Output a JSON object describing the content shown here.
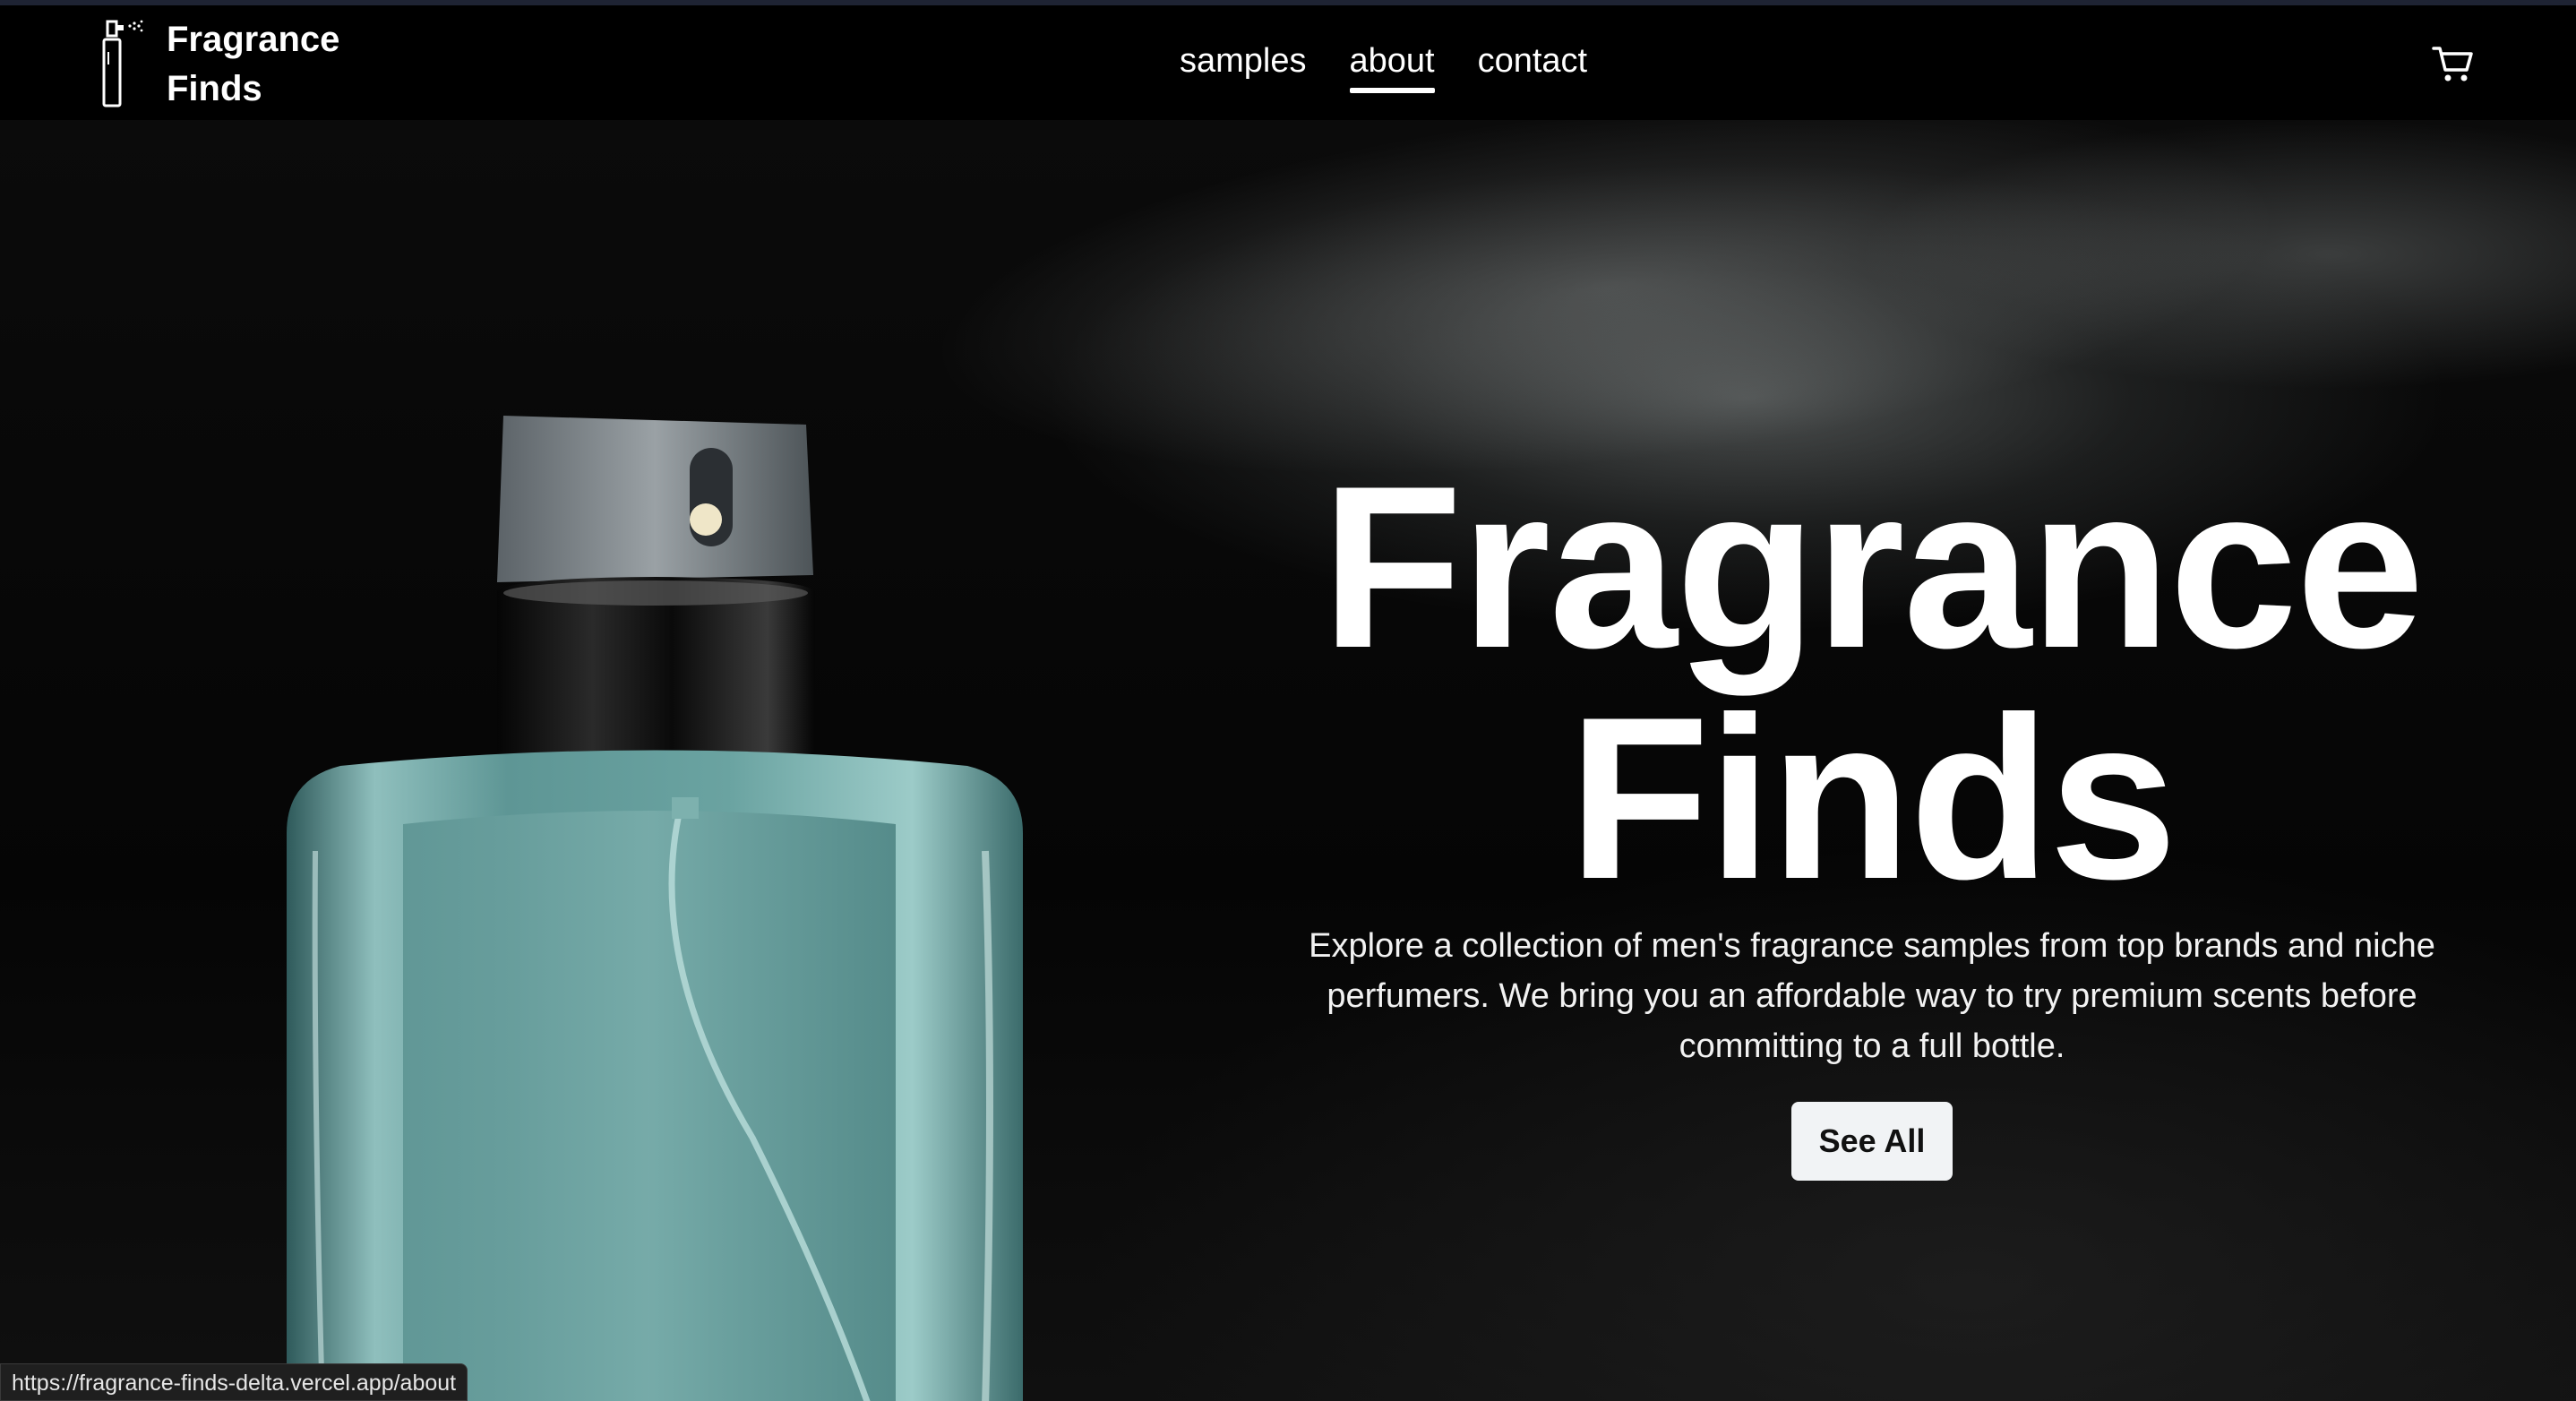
{
  "brand": {
    "name": "Fragrance Finds",
    "icon": "perfume-spray-icon"
  },
  "nav": {
    "links": [
      {
        "label": "samples",
        "active": false
      },
      {
        "label": "about",
        "active": true
      },
      {
        "label": "contact",
        "active": false
      }
    ],
    "cart_icon": "cart-icon"
  },
  "hero": {
    "title_line1": "Fragrance",
    "title_line2": "Finds",
    "description": "Explore a collection of men's fragrance samples from top brands and niche perfumers. We bring you an affordable way to try premium scents before committing to a full bottle.",
    "cta_label": "See All",
    "image": "perfume-bottle-spraying-image"
  },
  "status_bar": {
    "url": "https://fragrance-finds-delta.vercel.app/about"
  },
  "colors": {
    "background": "#000000",
    "button_bg": "#f1f3f5",
    "bottle_glass": "#5e9695"
  }
}
